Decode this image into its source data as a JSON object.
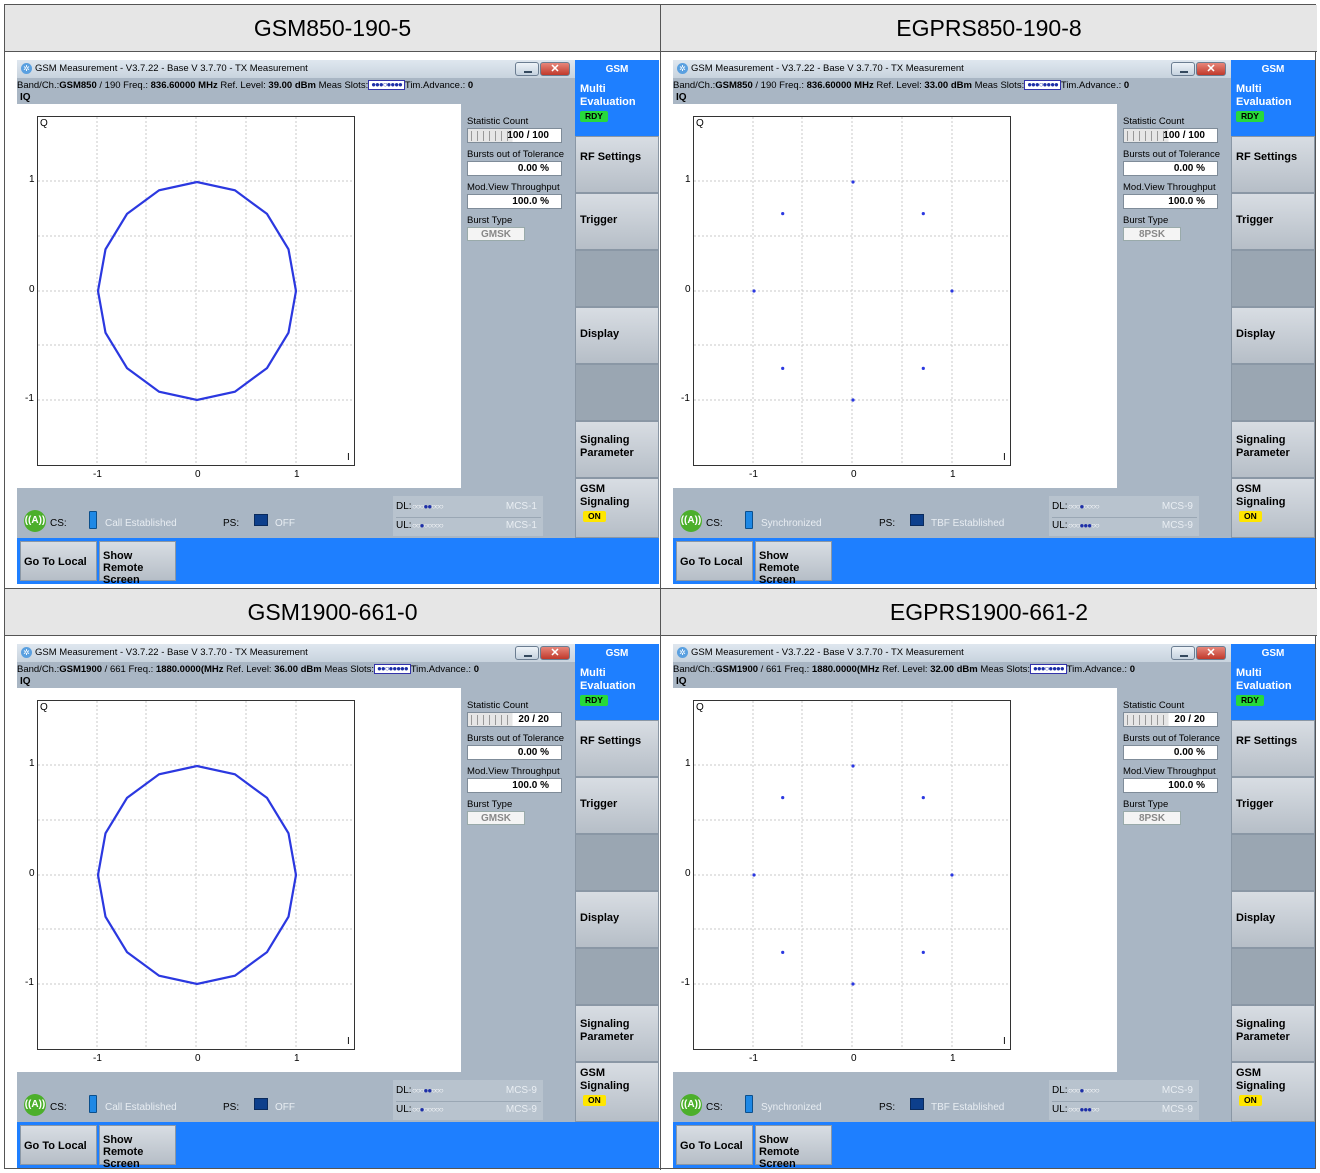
{
  "panels": [
    {
      "caption": "GSM850-190-5",
      "window_title": "GSM Measurement  - V3.7.22 - Base V 3.7.70 - TX Measurement",
      "band_ch_label": "Band/Ch.:",
      "band": "GSM850",
      "channel": "/  190",
      "freq_label": "Freq.:",
      "freq": "836.60000 MHz",
      "ref_label": "Ref. Level:",
      "ref_level": "39.00 dBm",
      "meas_slots_label": "Meas Slots:",
      "meas_slots": "●●●○●●●●",
      "tim_adv_label": "Tim.Advance.:",
      "tim_adv": "0",
      "view": "IQ",
      "q_axis": "Q",
      "i_axis": "I",
      "statistic_label": "Statistic Count",
      "statistic": "100 / 100",
      "bursts_label": "Bursts out of Tolerance",
      "bursts": "0.00  %",
      "throughput_label": "Mod.View Throughput",
      "throughput": "100.0  %",
      "burst_type_label": "Burst Type",
      "burst_type": "GMSK",
      "cs_label": "CS:",
      "cs_status": "Call Established",
      "ps_label": "PS:",
      "ps_status": "OFF",
      "dl_label": "DL:",
      "dl_dots": "○○○●●○○○",
      "dl_mcs": "MCS-1",
      "ul_label": "UL:",
      "ul_dots": "○○●○○○○○",
      "ul_mcs": "MCS-1"
    },
    {
      "caption": "EGPRS850-190-8",
      "window_title": "GSM Measurement  - V3.7.22 - Base V 3.7.70 - TX Measurement",
      "band_ch_label": "Band/Ch.:",
      "band": "GSM850",
      "channel": "/  190",
      "freq_label": "Freq.:",
      "freq": "836.60000 MHz",
      "ref_label": "Ref. Level:",
      "ref_level": "33.00 dBm",
      "meas_slots_label": "Meas Slots:",
      "meas_slots": "●●●○●●●●",
      "tim_adv_label": "Tim.Advance.:",
      "tim_adv": "0",
      "view": "IQ",
      "q_axis": "Q",
      "i_axis": "I",
      "statistic_label": "Statistic Count",
      "statistic": "100 / 100",
      "bursts_label": "Bursts out of Tolerance",
      "bursts": "0.00  %",
      "throughput_label": "Mod.View Throughput",
      "throughput": "100.0  %",
      "burst_type_label": "Burst Type",
      "burst_type": "8PSK",
      "cs_label": "CS:",
      "cs_status": "Synchronized",
      "ps_label": "PS:",
      "ps_status": "TBF Established",
      "dl_label": "DL:",
      "dl_dots": "○○○●○○○○",
      "dl_mcs": "MCS-9",
      "ul_label": "UL:",
      "ul_dots": "○○○●●●○○",
      "ul_mcs": "MCS-9"
    },
    {
      "caption": "GSM1900-661-0",
      "window_title": "GSM Measurement  - V3.7.22 - Base V 3.7.70 - TX Measurement",
      "band_ch_label": "Band/Ch.:",
      "band": "GSM1900",
      "channel": "/  661",
      "freq_label": "Freq.:",
      "freq": "1880.0000(MHz",
      "ref_label": "Ref. Level:",
      "ref_level": "36.00 dBm",
      "meas_slots_label": "Meas Slots:",
      "meas_slots": "●●○●●●●●",
      "tim_adv_label": "Tim.Advance.:",
      "tim_adv": "0",
      "view": "IQ",
      "q_axis": "Q",
      "i_axis": "I",
      "statistic_label": "Statistic Count",
      "statistic": "20 / 20",
      "bursts_label": "Bursts out of Tolerance",
      "bursts": "0.00  %",
      "throughput_label": "Mod.View Throughput",
      "throughput": "100.0  %",
      "burst_type_label": "Burst Type",
      "burst_type": "GMSK",
      "cs_label": "CS:",
      "cs_status": "Call Established",
      "ps_label": "PS:",
      "ps_status": "OFF",
      "dl_label": "DL:",
      "dl_dots": "○○○●●○○○",
      "dl_mcs": "MCS-9",
      "ul_label": "UL:",
      "ul_dots": "○○●○○○○○",
      "ul_mcs": "MCS-9"
    },
    {
      "caption": "EGPRS1900-661-2",
      "window_title": "GSM Measurement  - V3.7.22 - Base V 3.7.70 - TX Measurement",
      "band_ch_label": "Band/Ch.:",
      "band": "GSM1900",
      "channel": "/  661",
      "freq_label": "Freq.:",
      "freq": "1880.0000(MHz",
      "ref_label": "Ref. Level:",
      "ref_level": "32.00 dBm",
      "meas_slots_label": "Meas Slots:",
      "meas_slots": "●●●○●●●●",
      "tim_adv_label": "Tim.Advance.:",
      "tim_adv": "0",
      "view": "IQ",
      "q_axis": "Q",
      "i_axis": "I",
      "statistic_label": "Statistic Count",
      "statistic": "20 / 20",
      "bursts_label": "Bursts out of Tolerance",
      "bursts": "0.00  %",
      "throughput_label": "Mod.View Throughput",
      "throughput": "100.0  %",
      "burst_type_label": "Burst Type",
      "burst_type": "8PSK",
      "cs_label": "CS:",
      "cs_status": "Synchronized",
      "ps_label": "PS:",
      "ps_status": "TBF Established",
      "dl_label": "DL:",
      "dl_dots": "○○○●○○○○",
      "dl_mcs": "MCS-9",
      "ul_label": "UL:",
      "ul_dots": "○○○●●●○○",
      "ul_mcs": "MCS-9"
    }
  ],
  "sidebar": {
    "header": "GSM",
    "multi_eval": "Multi Evaluation",
    "rdy": "RDY",
    "rf_settings": "RF Settings",
    "trigger": "Trigger",
    "display": "Display",
    "signaling_param": "Signaling Parameter",
    "gsm_signaling": "GSM Signaling",
    "on": "ON"
  },
  "bottom": {
    "go_local": "Go To Local",
    "show_remote": "Show Remote Screen"
  },
  "chart_data": [
    {
      "type": "scatter",
      "title": "",
      "subtype": "GMSK constellation (circle)",
      "x_ticks": [
        "-1",
        "0",
        "1"
      ],
      "y_ticks": [
        "1",
        "0",
        "-1"
      ],
      "xlim": [
        -1.6,
        1.6
      ],
      "ylim": [
        -1.6,
        1.6
      ],
      "points": "ring of radius 1 (polygon with 16 vertices)",
      "color": "#2b38e0"
    },
    {
      "type": "scatter",
      "title": "",
      "subtype": "8PSK constellation",
      "x_ticks": [
        "-1",
        "0",
        "1"
      ],
      "y_ticks": [
        "1",
        "0",
        "-1"
      ],
      "xlim": [
        -1.6,
        1.6
      ],
      "ylim": [
        -1.6,
        1.6
      ],
      "x": [
        0,
        0.71,
        1,
        0.71,
        0,
        -0.71,
        -1,
        -0.71
      ],
      "y": [
        1,
        0.71,
        0,
        -0.71,
        -1,
        -0.71,
        0,
        0.71
      ],
      "color": "#2b38e0"
    },
    {
      "type": "scatter",
      "title": "",
      "subtype": "GMSK constellation (circle)",
      "x_ticks": [
        "-1",
        "0",
        "1"
      ],
      "y_ticks": [
        "1",
        "0",
        "-1"
      ],
      "xlim": [
        -1.6,
        1.6
      ],
      "ylim": [
        -1.6,
        1.6
      ],
      "points": "ring of radius 1 (polygon with 16 vertices)",
      "color": "#2b38e0"
    },
    {
      "type": "scatter",
      "title": "",
      "subtype": "8PSK constellation",
      "x_ticks": [
        "-1",
        "0",
        "1"
      ],
      "y_ticks": [
        "1",
        "0",
        "-1"
      ],
      "xlim": [
        -1.6,
        1.6
      ],
      "ylim": [
        -1.6,
        1.6
      ],
      "x": [
        0,
        0.71,
        1,
        0.71,
        0,
        -0.71,
        -1,
        -0.71
      ],
      "y": [
        1,
        0.71,
        0,
        -0.71,
        -1,
        -0.71,
        0,
        0.71
      ],
      "color": "#2b38e0"
    }
  ]
}
